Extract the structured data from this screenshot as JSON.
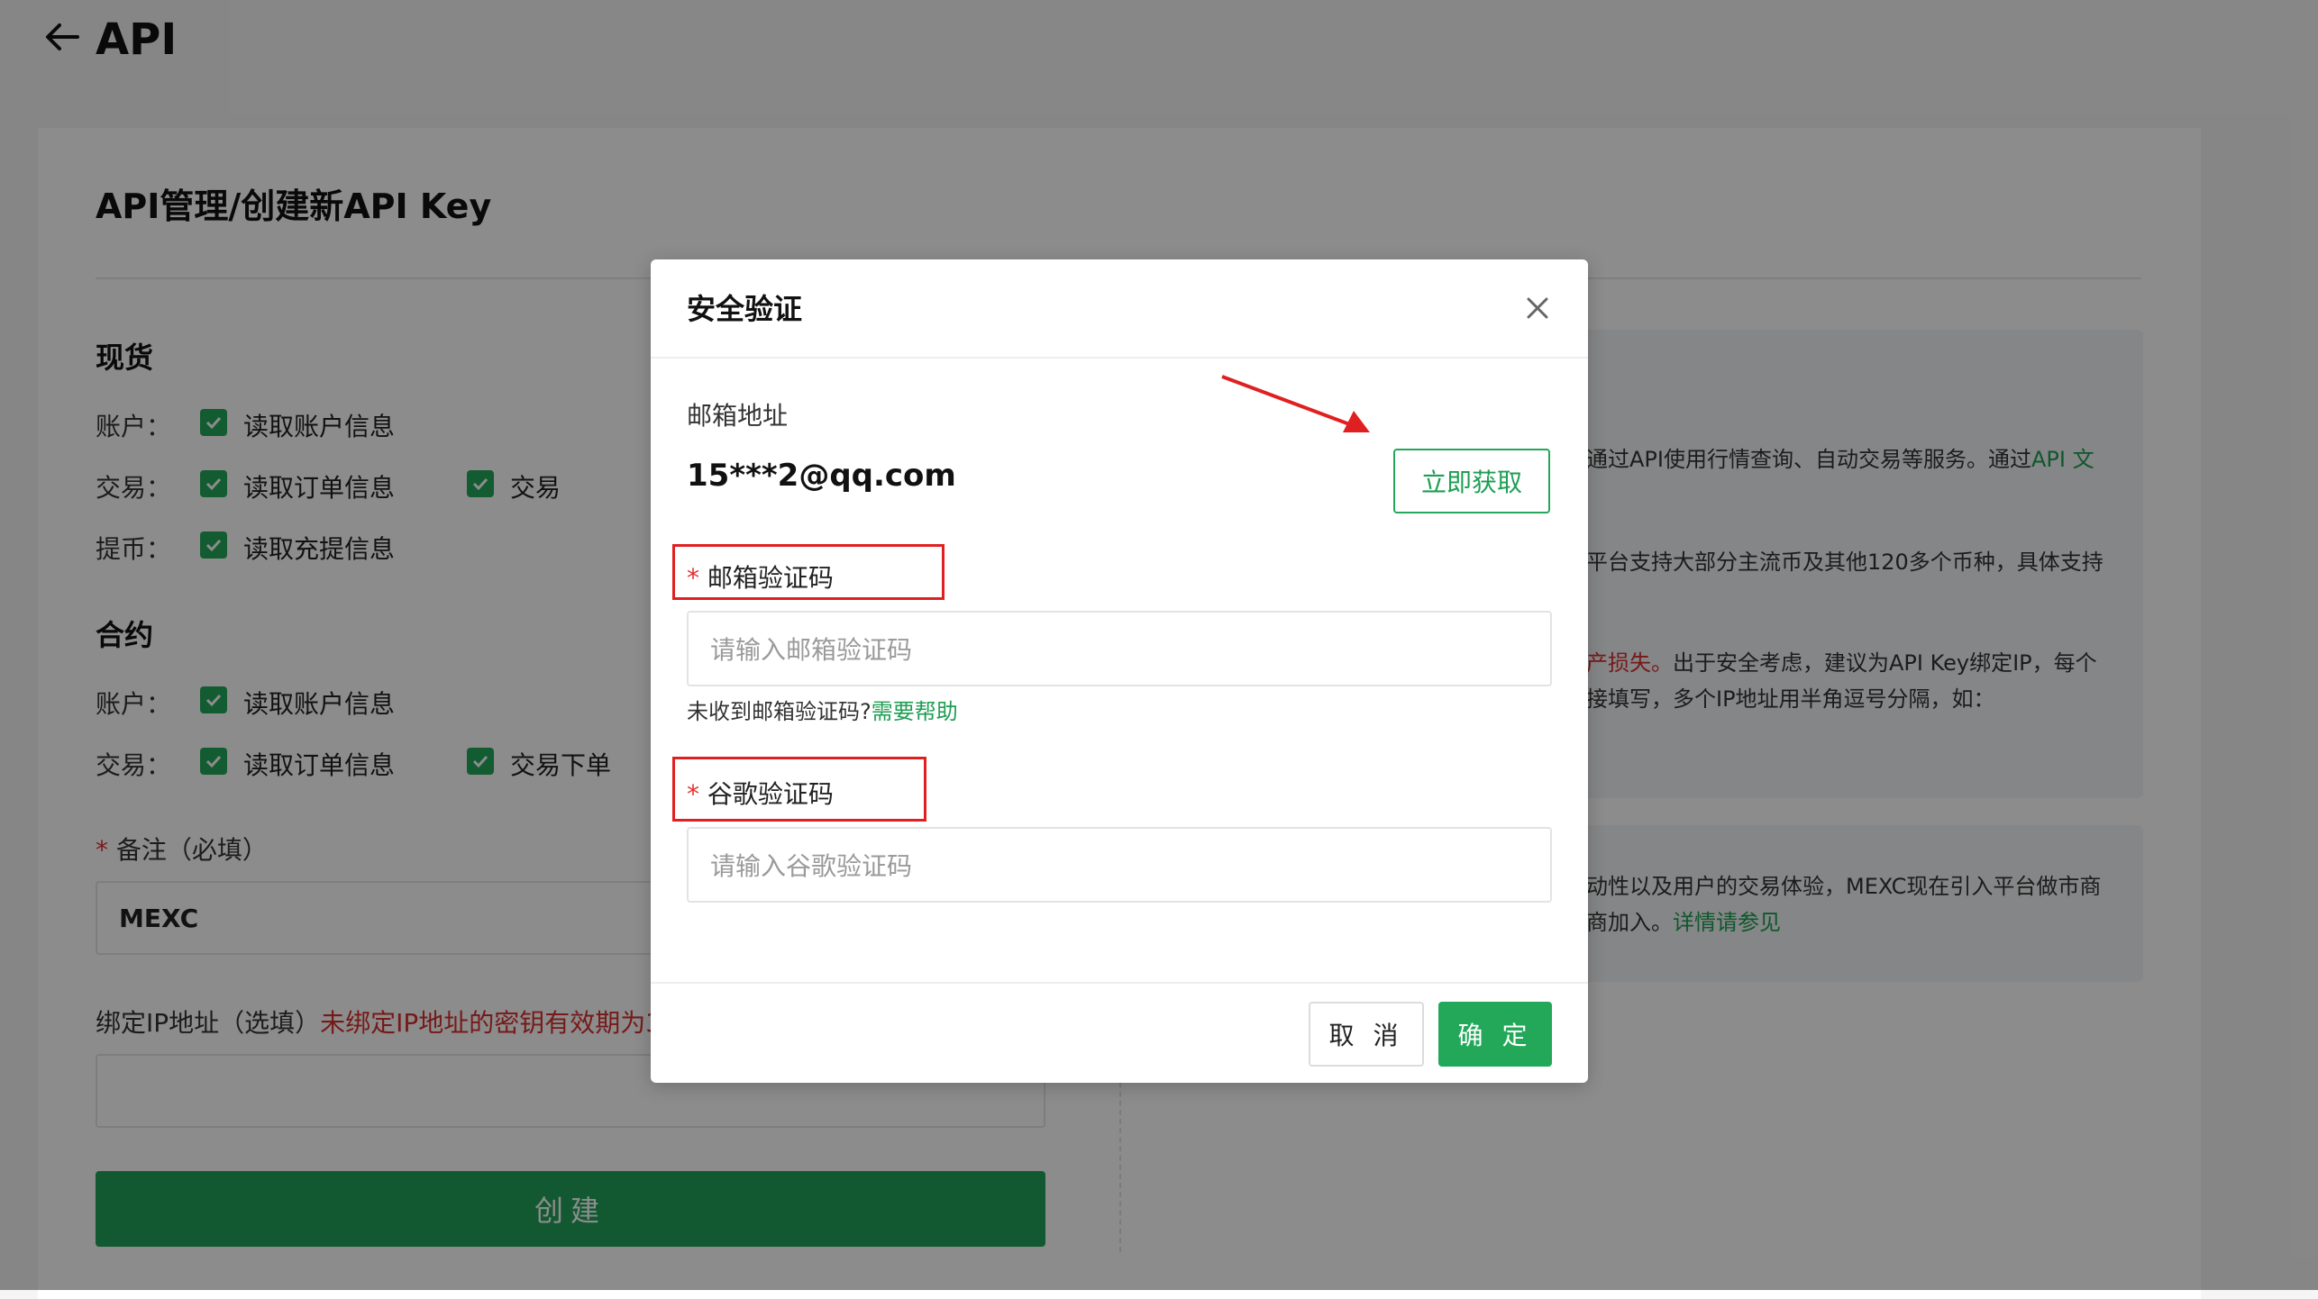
{
  "header": {
    "title": "API",
    "back_icon": "arrow-left-icon"
  },
  "page": {
    "title": "API管理/创建新API Key"
  },
  "spot": {
    "title": "现货",
    "rows": [
      {
        "label": "账户：",
        "items": [
          "读取账户信息"
        ]
      },
      {
        "label": "交易：",
        "items": [
          "读取订单信息",
          "交易"
        ]
      },
      {
        "label": "提币：",
        "items": [
          "读取充提信息"
        ]
      }
    ]
  },
  "contract": {
    "title": "合约",
    "rows": [
      {
        "label": "账户：",
        "items": [
          "读取账户信息"
        ]
      },
      {
        "label": "交易：",
        "items": [
          "读取订单信息",
          "交易下单"
        ]
      }
    ]
  },
  "remark": {
    "star": "*",
    "label": "备注（必填）",
    "value": "MEXC"
  },
  "ip": {
    "label": "绑定IP地址（选填）",
    "warning": "未绑定IP地址的密钥有效期为3"
  },
  "create_button": "创建",
  "info": {
    "line1a": "通过API使用行情查询、自动交易等服务。通过",
    "line1_link": "API 文",
    "line2": "平台支持大部分主流币及其他120多个币种，具体支持",
    "line3_warn": "产损失。",
    "line3b": "出于安全考虑，建议为API Key绑定IP，每个",
    "line4": "接填写，多个IP地址用半角逗号分隔，如：",
    "line5": "动性以及用户的交易体验，MEXC现在引入平台做市商",
    "line6a": "商加入。",
    "line6_link": "详情请参见"
  },
  "modal": {
    "title": "安全验证",
    "close_icon": "close-icon",
    "email_label": "邮箱地址",
    "email_value": "15***2@qq.com",
    "get_code_button": "立即获取",
    "email_code": {
      "star": "*",
      "label": "邮箱验证码",
      "placeholder": "请输入邮箱验证码"
    },
    "help_text": "未收到邮箱验证码?",
    "help_link": "需要帮助",
    "google_code": {
      "star": "*",
      "label": "谷歌验证码",
      "placeholder": "请输入谷歌验证码"
    },
    "cancel_button": "取 消",
    "ok_button": "确 定"
  },
  "colors": {
    "accent": "#23a85a",
    "warning": "#d8302f",
    "annotation": "#e02020"
  }
}
